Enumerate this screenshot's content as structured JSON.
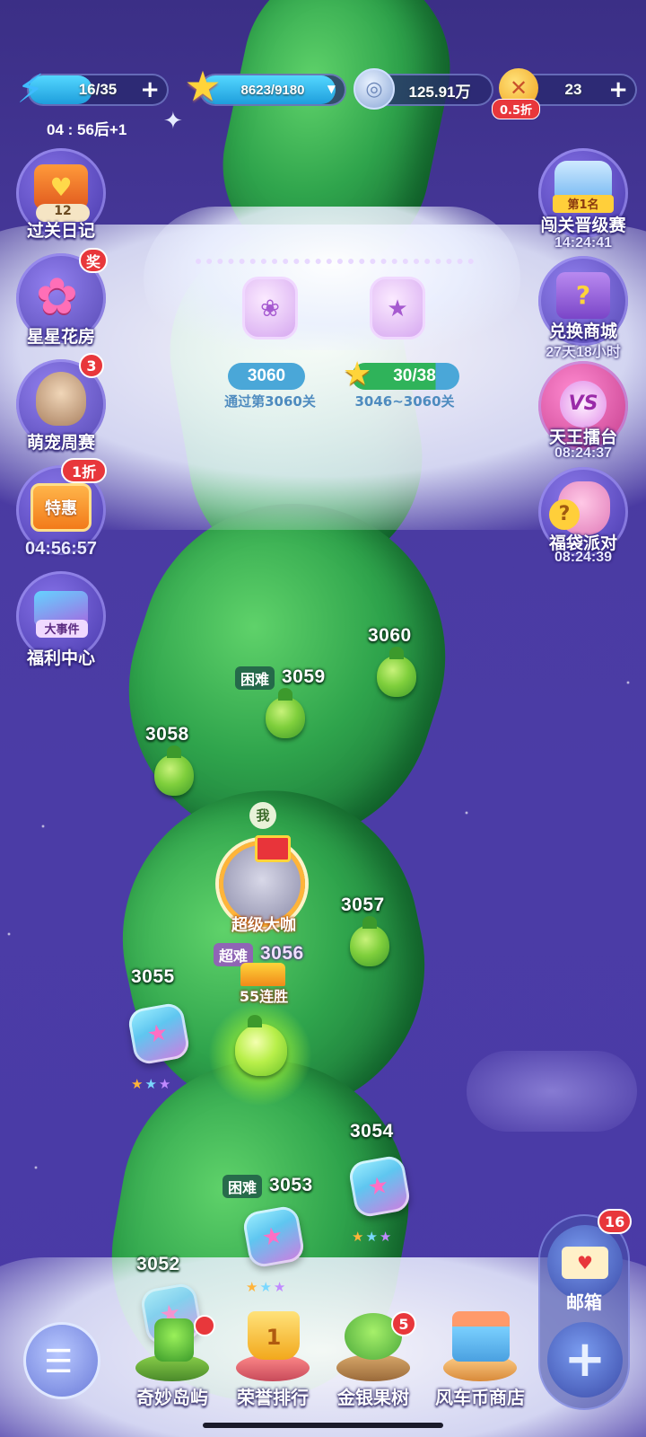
{
  "resources": {
    "energy": {
      "value": "16/35",
      "fill_fraction": 0.46,
      "sub": "04 : 56后+1"
    },
    "stars": {
      "value": "8623/9180",
      "fill_fraction": 0.94
    },
    "coins": {
      "value": "125.91万"
    },
    "tickets": {
      "value": "23",
      "discount": "0.5折"
    }
  },
  "left_menu": [
    {
      "label": "过关日记",
      "count": "12"
    },
    {
      "label": "星星花房",
      "badge": "奖"
    },
    {
      "label": "萌宠周赛",
      "badge": "3"
    },
    {
      "label": "特惠",
      "badge": "1折",
      "timer": "04:56:57"
    },
    {
      "label": "福利中心",
      "sublabel": "大事件"
    }
  ],
  "right_menu": [
    {
      "label": "闯关晋级赛",
      "tag": "第1名",
      "timer": "14:24:41"
    },
    {
      "label": "兑换商城",
      "timer": "27天18小时"
    },
    {
      "label": "天王擂台",
      "tag": "VS",
      "timer": "08:24:37"
    },
    {
      "label": "福袋派对",
      "timer": "08:24:39"
    }
  ],
  "chest": {
    "level_value": "3060",
    "level_caption": "通过第3060关",
    "stars_value": "30/38",
    "stars_caption": "3046~3060关"
  },
  "levels": [
    {
      "num": "3060"
    },
    {
      "num": "3059",
      "difficulty": "困难"
    },
    {
      "num": "3058"
    },
    {
      "num": "3057"
    },
    {
      "num": "3056",
      "difficulty": "超难",
      "streak": "55连胜"
    },
    {
      "num": "3055"
    },
    {
      "num": "3054"
    },
    {
      "num": "3053",
      "difficulty": "困难"
    },
    {
      "num": "3052"
    }
  ],
  "player": {
    "me_label": "我",
    "title": "超级大咖"
  },
  "mailbox": {
    "label": "邮箱",
    "badge": "16"
  },
  "bottom_nav": [
    {
      "label": "奇妙岛屿",
      "badge": ""
    },
    {
      "label": "荣誉排行",
      "rank": "1"
    },
    {
      "label": "金银果树",
      "badge": "5"
    },
    {
      "label": "风车币商店"
    }
  ],
  "colors": {
    "accent": "#1e9edc",
    "badge": "#e8373b",
    "background": "#4a3aa0",
    "vine": "#2fa44c"
  }
}
